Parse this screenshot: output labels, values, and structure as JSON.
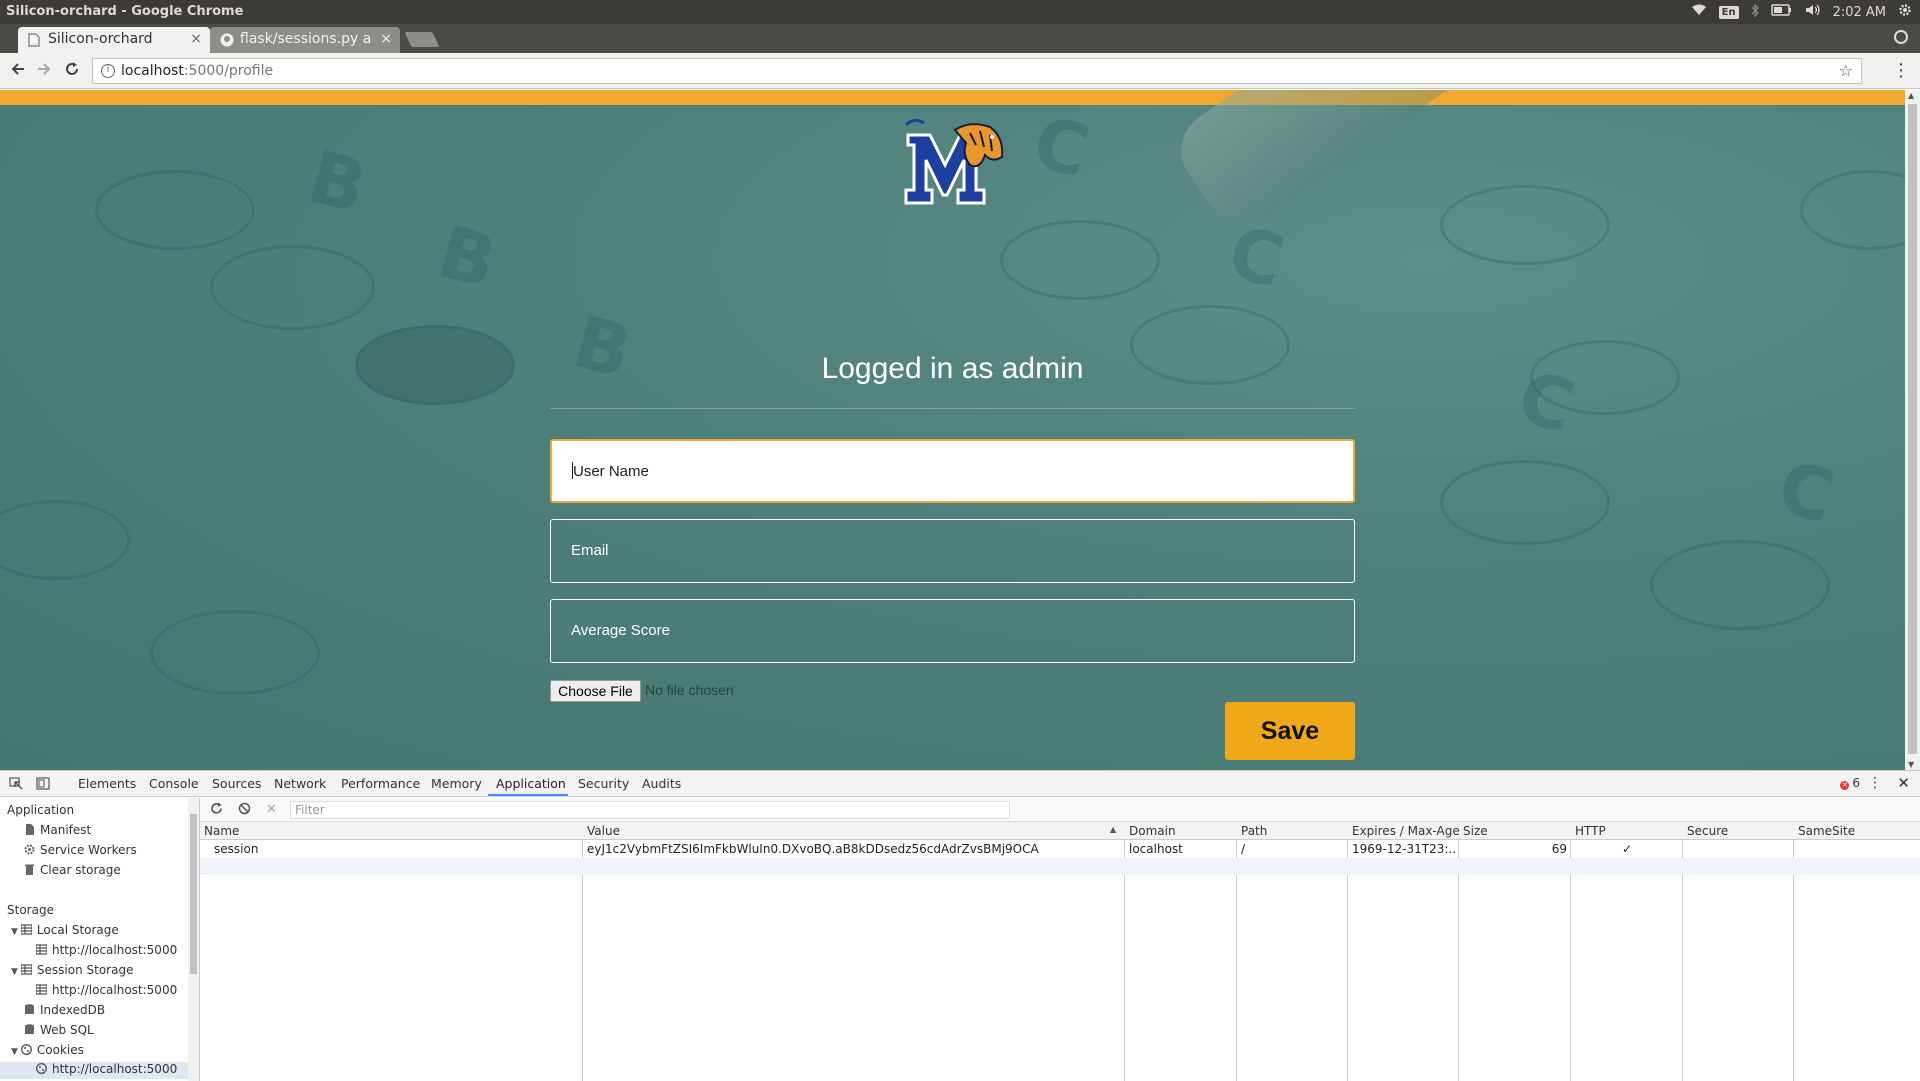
{
  "os": {
    "window_title": "Silicon-orchard - Google Chrome",
    "lang": "En",
    "clock": "2:02 AM"
  },
  "tabs": [
    {
      "label": "Silicon-orchard",
      "close": "×"
    },
    {
      "label": "flask/sessions.py a",
      "close": "×"
    }
  ],
  "address": {
    "host": "localhost",
    "path": ":5000/profile"
  },
  "page": {
    "heading": "Logged in as admin",
    "username_placeholder": "User Name",
    "email_placeholder": "Email",
    "score_placeholder": "Average Score",
    "choose_file": "Choose File",
    "no_file": "No file chosen",
    "save": "Save"
  },
  "devtools": {
    "tabs": [
      "Elements",
      "Console",
      "Sources",
      "Network",
      "Performance",
      "Memory",
      "Application",
      "Security",
      "Audits"
    ],
    "active_tab": "Application",
    "error_count": "6",
    "filter_placeholder": "Filter",
    "sidebar": {
      "application_header": "Application",
      "application_items": [
        "Manifest",
        "Service Workers",
        "Clear storage"
      ],
      "storage_header": "Storage",
      "local_storage": "Local Storage",
      "local_storage_origin": "http://localhost:5000",
      "session_storage": "Session Storage",
      "session_storage_origin": "http://localhost:5000",
      "indexeddb": "IndexedDB",
      "websql": "Web SQL",
      "cookies": "Cookies",
      "cookies_origin": "http://localhost:5000"
    },
    "table": {
      "headers": [
        "Name",
        "Value",
        "Domain",
        "Path",
        "Expires / Max-Age",
        "Size",
        "HTTP",
        "Secure",
        "SameSite"
      ],
      "rows": [
        {
          "name": "session",
          "value": "eyJ1c2VybmFtZSI6ImFkbWluIn0.DXvoBQ.aB8kDDsedz56cdAdrZvsBMj9OCA",
          "domain": "localhost",
          "path": "/",
          "expires": "1969-12-31T23:...",
          "size": "69",
          "http": "✓",
          "secure": "",
          "samesite": ""
        }
      ]
    }
  },
  "colors": {
    "accent_orange": "#f0a830",
    "page_teal": "#4f807b",
    "devtools_blue": "#4a8af4"
  }
}
